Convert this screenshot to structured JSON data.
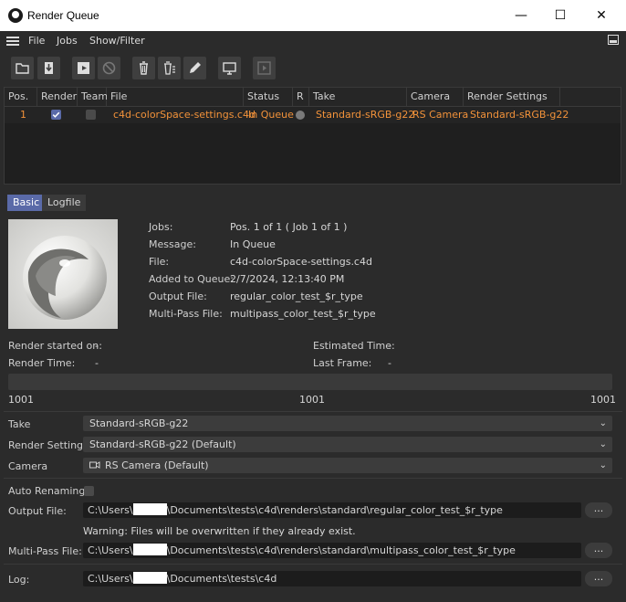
{
  "window": {
    "title": "Render Queue",
    "minimize": "—",
    "maximize": "☐",
    "close": "✕"
  },
  "menu": {
    "items": [
      "File",
      "Jobs",
      "Show/Filter"
    ]
  },
  "table": {
    "columns": [
      "Pos.",
      "Render",
      "Team",
      "File",
      "Status",
      "R",
      "Take",
      "Camera",
      "Render Settings"
    ],
    "rows": [
      {
        "pos": "1",
        "render": true,
        "team": false,
        "file": "c4d-colorSpace-settings.c4d",
        "status": "In Queue",
        "take": "Standard-sRGB-g22",
        "camera": "RS Camera",
        "render_settings": "Standard-sRGB-g22"
      }
    ]
  },
  "tabs": [
    "Basic",
    "Logfile"
  ],
  "info": {
    "jobs_label": "Jobs:",
    "jobs": "Pos. 1 of 1 ( Job 1 of 1 )",
    "message_label": "Message:",
    "message": "In Queue",
    "file_label": "File:",
    "file": "c4d-colorSpace-settings.c4d",
    "added_label": "Added to Queue:",
    "added": "2/7/2024, 12:13:40 PM",
    "output_label": "Output File:",
    "output": "regular_color_test_$r_type",
    "multipass_label": "Multi-Pass File:",
    "multipass": "multipass_color_test_$r_type"
  },
  "stats": {
    "started_label": "Render started on:",
    "started": "-",
    "time_label": "Render Time:",
    "time": "-",
    "estimated_label": "Estimated Time:",
    "estimated": "-",
    "lastframe_label": "Last Frame:",
    "lastframe": "-"
  },
  "progress": {
    "value": 0,
    "start": "1001",
    "mid": "1001",
    "end": "1001"
  },
  "settings": {
    "take_label": "Take",
    "take": "Standard-sRGB-g22",
    "rs_label": "Render Settings",
    "rs": "Standard-sRGB-g22 (Default)",
    "camera_label": "Camera",
    "camera": "RS Camera (Default)",
    "autorename_label": "Auto Renaming",
    "output_label": "Output File:",
    "output_pre": "C:\\Users\\",
    "output_post": "\\Documents\\tests\\c4d\\renders\\standard\\regular_color_test_$r_type",
    "warning": "Warning: Files will be overwritten if they already exist.",
    "multipass_label": "Multi-Pass File:",
    "multipass_pre": "C:\\Users\\",
    "multipass_post": "\\Documents\\tests\\c4d\\renders\\standard\\multipass_color_test_$r_type",
    "log_label": "Log:",
    "log_pre": "C:\\Users\\",
    "log_post": "\\Documents\\tests\\c4d",
    "browse": "..."
  },
  "colors": {
    "accent_orange": "#f2923a",
    "tab_active": "#5a6aa8"
  }
}
